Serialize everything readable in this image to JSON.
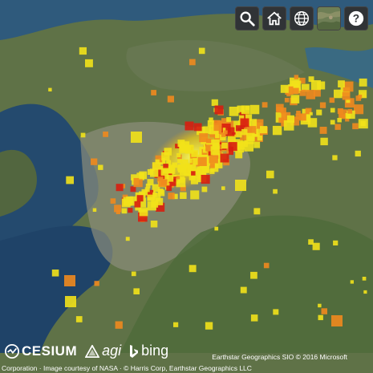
{
  "toolbar": {
    "search": {
      "icon": "search-icon"
    },
    "home": {
      "icon": "home-icon"
    },
    "scene_mode": {
      "icon": "globe-icon"
    },
    "base_layer": {
      "icon": "satellite-map-icon"
    },
    "help": {
      "icon": "help-icon",
      "label": "?"
    }
  },
  "credits": {
    "cesium_logo": "CESIUM",
    "agi_logo": "agi",
    "bing_logo": "bing",
    "imagery_credit": "Earthstar Geographics SIO © 2016 Microsoft",
    "attribution_line": "Corporation · Image courtesy of NASA · © Harris Corp, Earthstar Geographics LLC"
  },
  "colors": {
    "sea": "#244a6e",
    "land": "#5d7048",
    "point_low": "#f2e21a",
    "point_mid": "#f08a1e",
    "point_high": "#d81e10"
  }
}
